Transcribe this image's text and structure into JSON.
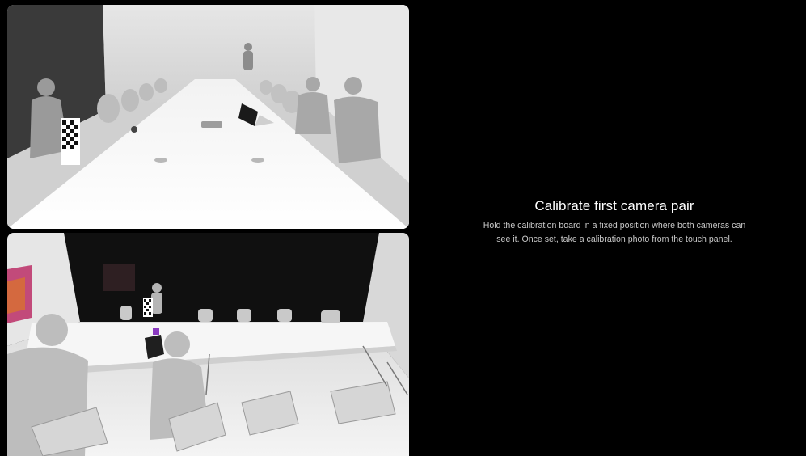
{
  "instructions": {
    "title": "Calibrate first camera pair",
    "body": "Hold the calibration board in a fixed position where both cameras can see it. Once set, take a calibration photo from the touch panel."
  },
  "colors": {
    "background": "#000000",
    "title": "#ffffff",
    "body": "#c8c8c8"
  }
}
